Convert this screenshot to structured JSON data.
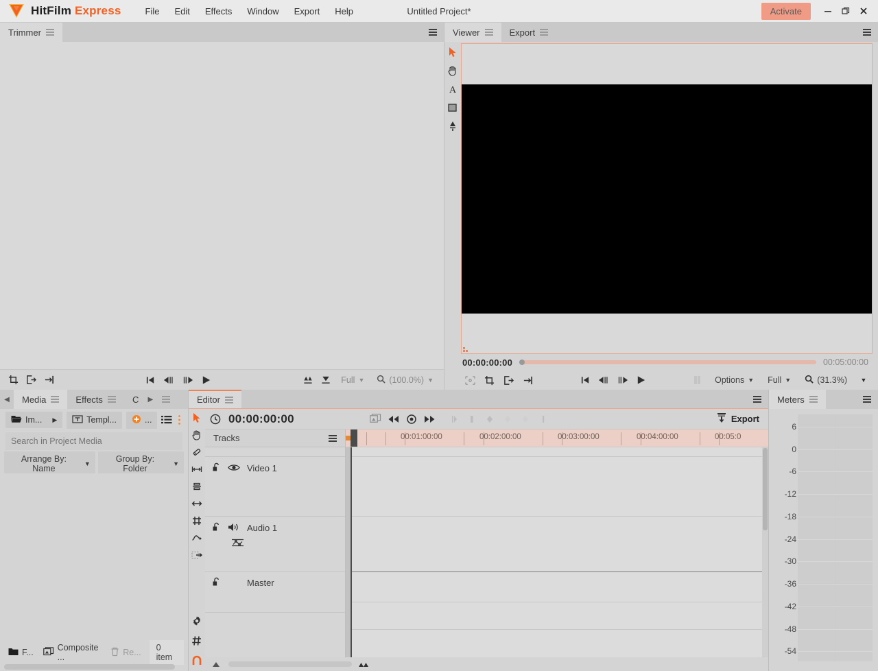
{
  "app": {
    "brand_primary": "HitFilm",
    "brand_secondary": "Express",
    "project_title": "Untitled Project*",
    "activate_label": "Activate",
    "accent_color": "#f26122",
    "activate_bg": "#ef9b85"
  },
  "menubar": [
    {
      "label": "File"
    },
    {
      "label": "Edit"
    },
    {
      "label": "Effects"
    },
    {
      "label": "Window"
    },
    {
      "label": "Export"
    },
    {
      "label": "Help"
    }
  ],
  "window_controls": {
    "minimize": "—",
    "maximize": "❐",
    "close": "✕"
  },
  "trimmer": {
    "tab_label": "Trimmer",
    "toolbar": {
      "crop_icon": "crop-icon",
      "export_out_icon": "set-out-point-icon",
      "import_in_icon": "set-in-point-icon",
      "go_start": "⏮",
      "step_back": "◁|",
      "step_fwd": "|▷",
      "play": "▶",
      "insert_icon": "insert-icon",
      "overwrite_icon": "overwrite-icon",
      "quality_label": "Full",
      "zoom_label": "(100.0%)"
    }
  },
  "viewer": {
    "tabs": [
      {
        "label": "Viewer",
        "active": true
      },
      {
        "label": "Export",
        "active": false
      }
    ],
    "tools": [
      {
        "name": "select-tool-icon",
        "selected": true
      },
      {
        "name": "hand-tool-icon",
        "selected": false
      },
      {
        "name": "text-tool-icon",
        "selected": false
      },
      {
        "name": "rectangle-tool-icon",
        "selected": false
      },
      {
        "name": "pen-tool-icon",
        "selected": false
      }
    ],
    "timecode_current": "00:00:00:00",
    "timecode_duration": "00:05:00:00",
    "bottom": {
      "safe_areas_icon": "safe-areas-icon",
      "crop_icon": "crop-icon",
      "out_icon": "set-out-point-icon",
      "in_icon": "set-in-point-icon",
      "go_start": "⏮",
      "step_back": "◁|",
      "step_fwd": "|▷",
      "play": "▶",
      "options_label": "Options",
      "quality_label": "Full",
      "zoom_label": "(31.3%)"
    }
  },
  "media": {
    "tabs": [
      {
        "label": "Media",
        "active": true
      },
      {
        "label": "Effects",
        "active": false
      },
      {
        "label": "C",
        "active": false
      }
    ],
    "toolbar": {
      "import_label": "Im...",
      "templates_label": "Templ...",
      "new_label": "...",
      "list_view_icon": "list-view-icon"
    },
    "search_placeholder": "Search in Project Media",
    "arrange_by": "Arrange By: Name",
    "group_by": "Group By: Folder",
    "footer": {
      "folder_label": "F...",
      "composite_label": "Composite ...",
      "remove_label": "Re...",
      "item_count": "0 item"
    }
  },
  "editor": {
    "tab_label": "Editor",
    "tools": [
      {
        "name": "select-tool-icon",
        "selected": true
      },
      {
        "name": "hand-tool-icon",
        "selected": false
      },
      {
        "name": "slice-tool-icon",
        "selected": false
      },
      {
        "name": "slip-tool-icon",
        "selected": false
      },
      {
        "name": "slide-tool-icon",
        "selected": false
      },
      {
        "name": "ripple-tool-icon",
        "selected": false
      },
      {
        "name": "transform-tool-icon",
        "selected": false
      },
      {
        "name": "rate-stretch-tool-icon",
        "selected": false
      },
      {
        "name": "crop-tool-icon",
        "selected": false
      }
    ],
    "bottom_tools": [
      {
        "name": "settings-gear-icon",
        "selected": false
      },
      {
        "name": "snap-grid-icon",
        "selected": false
      },
      {
        "name": "magnet-snapping-icon",
        "selected": true
      }
    ],
    "timecode": "00:00:00:00",
    "toolbar": {
      "composite_shot_icon": "new-composite-shot-icon",
      "rewind_icon": "«",
      "record_icon": "◉",
      "forward_icon": "»",
      "export_label": "Export"
    },
    "tracks_header": "Tracks",
    "tracks": [
      {
        "name": "Video 1",
        "lock_icon": "lock-open-icon",
        "visibility_icon": "eye-icon",
        "type": "video"
      },
      {
        "name": "Audio 1",
        "lock_icon": "lock-open-icon",
        "audio_icon": "speaker-icon",
        "keyframe_icon": "audio-keyframe-icon",
        "type": "audio"
      },
      {
        "name": "Master",
        "lock_icon": "lock-open-icon",
        "type": "master"
      }
    ],
    "ruler_labels": [
      "00:01:00:00",
      "00:02:00:00",
      "00:03:00:00",
      "00:04:00:00",
      "00:05:0"
    ]
  },
  "meters": {
    "tab_label": "Meters",
    "scale": [
      6,
      0,
      -6,
      -12,
      -18,
      -24,
      -30,
      -36,
      -42,
      -48,
      -54
    ],
    "channels": 2
  }
}
